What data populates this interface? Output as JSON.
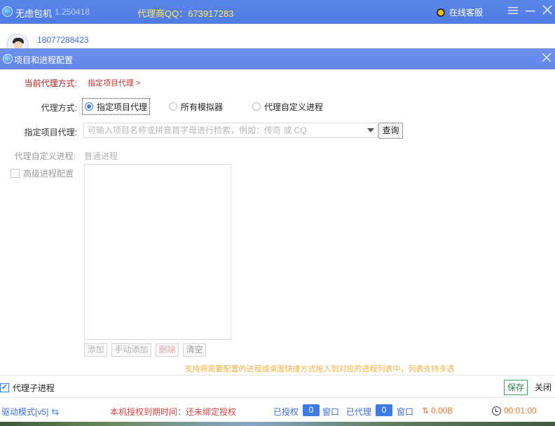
{
  "app": {
    "name": "无虑包机",
    "version": "1.250418",
    "agent_qq": "代理商QQ：673917283",
    "service": "在线客服",
    "window_controls": [
      "menu-icon",
      "minimize-icon",
      "close-icon"
    ]
  },
  "user": {
    "phone": "18077288423"
  },
  "dialog": {
    "title": "项目和进程配置",
    "current_mode_label": "当前代理方式:",
    "current_mode_value": "指定项目代理 >",
    "proxy_mode_label": "代理方式:",
    "proxy_modes": [
      {
        "label": "指定项目代理",
        "selected": true
      },
      {
        "label": "所有模拟器",
        "selected": false
      },
      {
        "label": "代理自定义进程",
        "selected": false
      }
    ],
    "project_label": "指定项目代理:",
    "project_placeholder": "可输入项目名称或拼音首字母进行检索，例如：传奇 或 CQ",
    "query_button": "查询",
    "custom_process_label": "代理自定义进程:",
    "process_type": "普通进程",
    "advanced_label": "高级进程配置",
    "advanced_checked": false,
    "list_buttons": {
      "add": "添加",
      "manual_add": "手动添加",
      "delete": "删除",
      "clear": "清空"
    },
    "tip": "支持将需要配置的进程或桌面快捷方式拖入到对应的进程列表中，列表支持多选",
    "child_process_label": "代理子进程",
    "child_process_checked": true,
    "save": "保存",
    "close": "关闭"
  },
  "status": {
    "mode": "驱动模式[v5]",
    "auth": "本机授权到期时间：还未绑定授权",
    "authorized_label": "已授权",
    "authorized_count": "0",
    "window1": "窗口",
    "proxied_label": "已代理",
    "proxied_count": "0",
    "window2": "窗口",
    "speed": "0.00B",
    "timer": "00:01:00"
  },
  "colors": {
    "titlebar": "#5b86e8",
    "dialog_titlebar": "#6286ea",
    "accent": "#3a7ee8",
    "warning_red": "#d03030",
    "tip_orange": "#f0b040",
    "agent_yellow": "#ffe860"
  }
}
